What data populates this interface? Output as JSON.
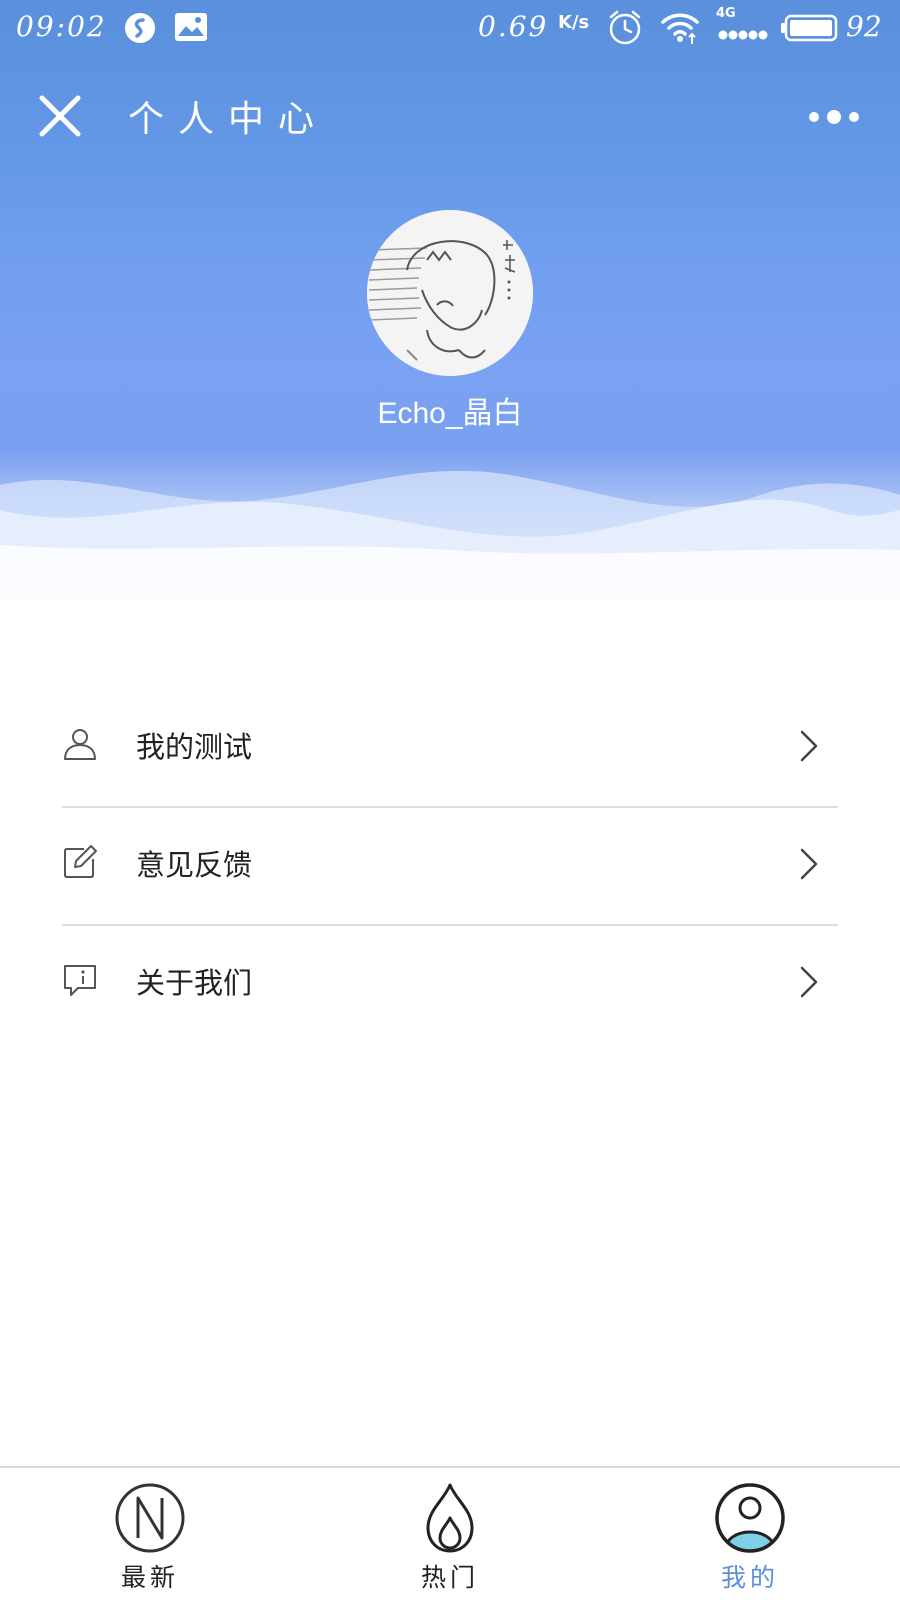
{
  "status_bar": {
    "time": "09:02",
    "net_speed": "0.69",
    "net_speed_unit": "K/s",
    "network_type": "4G",
    "battery_level": "92",
    "icons": [
      "sync-icon",
      "image-icon",
      "alarm-icon",
      "wifi-icon",
      "signal-icon",
      "battery-icon"
    ]
  },
  "header": {
    "title": "个人中心",
    "close_icon": "close-icon",
    "more_icon": "more-dots-icon"
  },
  "profile": {
    "username": "Echo_晶白"
  },
  "menu": {
    "items": [
      {
        "label": "我的测试",
        "icon": "user-icon"
      },
      {
        "label": "意见反馈",
        "icon": "edit-icon"
      },
      {
        "label": "关于我们",
        "icon": "info-chat-icon"
      }
    ]
  },
  "tabs": [
    {
      "label": "最新",
      "icon": "new-n-icon",
      "active": false
    },
    {
      "label": "热门",
      "icon": "flame-icon",
      "active": false
    },
    {
      "label": "我的",
      "icon": "profile-icon",
      "active": true
    }
  ],
  "colors": {
    "header_blue": "#5a8fdc",
    "accent_active": "#5a8fdc",
    "divider": "#dcdcdc",
    "avatar_accent": "#7fcfe8"
  }
}
